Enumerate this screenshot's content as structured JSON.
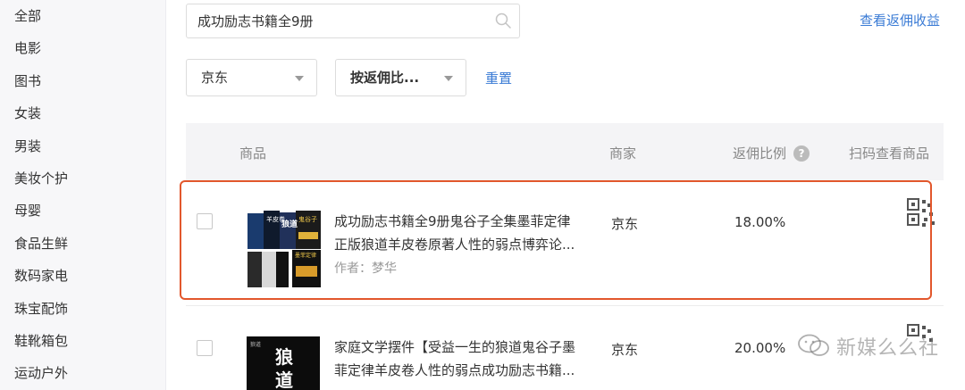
{
  "sidebar": {
    "items": [
      {
        "label": "全部"
      },
      {
        "label": "电影"
      },
      {
        "label": "图书"
      },
      {
        "label": "女装"
      },
      {
        "label": "男装"
      },
      {
        "label": "美妆个护"
      },
      {
        "label": "母婴"
      },
      {
        "label": "食品生鲜"
      },
      {
        "label": "数码家电"
      },
      {
        "label": "珠宝配饰"
      },
      {
        "label": "鞋靴箱包"
      },
      {
        "label": "运动户外"
      }
    ]
  },
  "search": {
    "value": "成功励志书籍全9册",
    "icon": "search-icon"
  },
  "header": {
    "earnings_link": "查看返佣收益"
  },
  "filters": {
    "platform": "京东",
    "sort": "按返佣比...",
    "reset": "重置"
  },
  "table": {
    "columns": {
      "product": "商品",
      "merchant": "商家",
      "ratio": "返佣比例",
      "qr": "扫码查看商品"
    },
    "help_icon": "?",
    "rows": [
      {
        "title_line1": "成功励志书籍全9册鬼谷子全集墨菲定律",
        "title_line2": "正版狼道羊皮卷原著人性的弱点博弈论...",
        "author": "作者：梦华",
        "merchant": "京东",
        "ratio": "18.00%",
        "cover_text": [
          "羊皮卷",
          "狼道",
          "鬼谷子",
          "墨菲定律"
        ]
      },
      {
        "title_line1": "家庭文学摆件【受益一生的狼道鬼谷子墨",
        "title_line2": "菲定律羊皮卷人性的弱点成功励志书籍...",
        "merchant": "京东",
        "ratio": "20.00%",
        "cover_text": [
          "狼道",
          "狼",
          "道"
        ]
      }
    ]
  },
  "watermark": {
    "text": "新媒么么社"
  },
  "colors": {
    "accent_link": "#3a7bd5",
    "highlight_border": "#e2572c",
    "sidebar_bg": "#f7f7f9",
    "header_bg": "#f4f4f6"
  }
}
